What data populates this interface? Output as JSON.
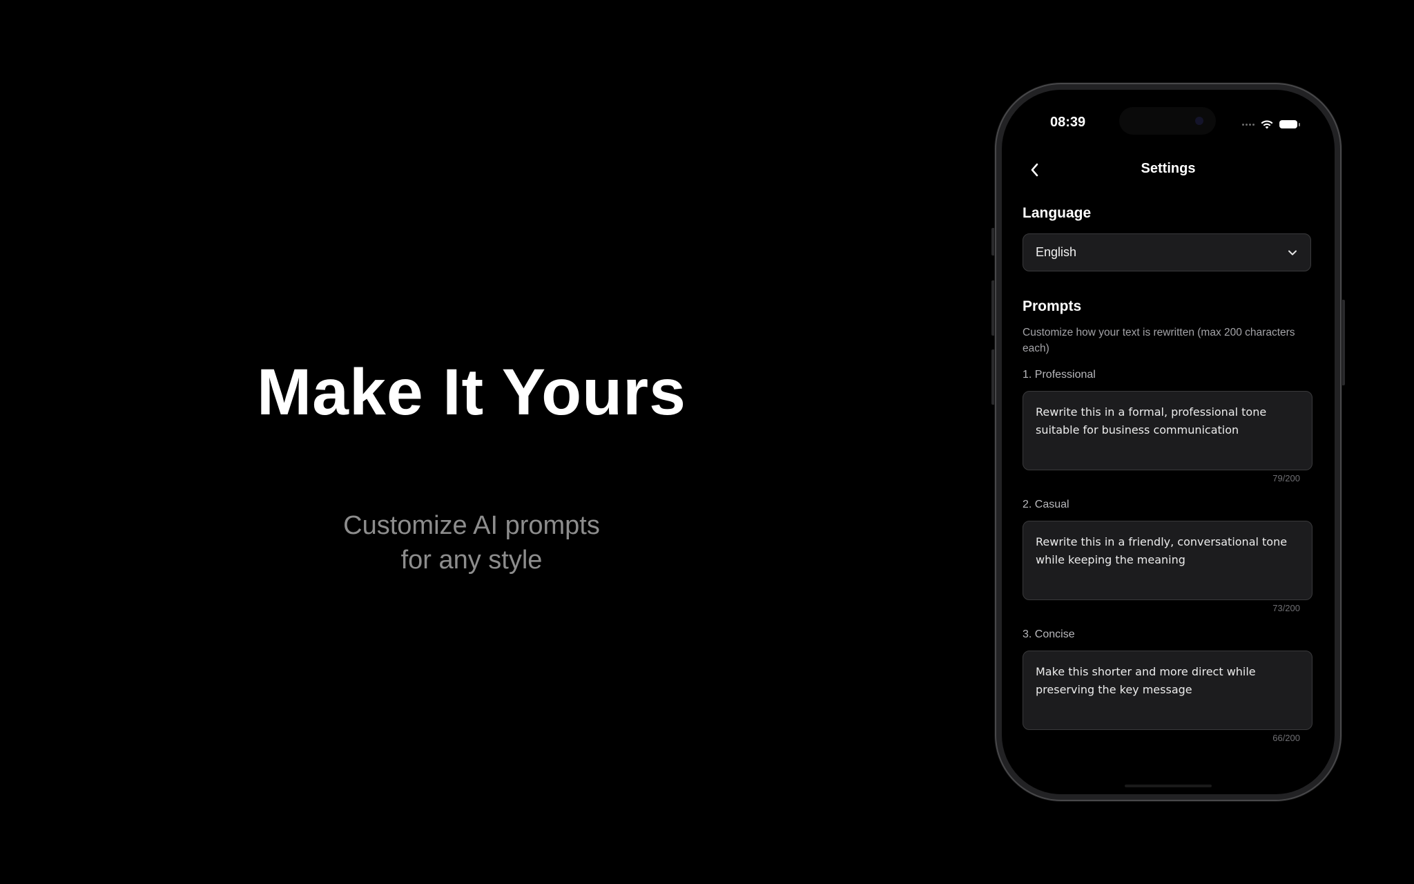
{
  "hero": {
    "title": "Make It Yours",
    "subtitle_line1": "Customize AI prompts",
    "subtitle_line2": "for any style"
  },
  "status_bar": {
    "time": "08:39",
    "icons": [
      "signal-dots-icon",
      "wifi-icon",
      "battery-icon"
    ]
  },
  "nav": {
    "title": "Settings",
    "back_icon": "chevron-left-icon"
  },
  "language": {
    "section_title": "Language",
    "selected": "English",
    "dropdown_icon": "chevron-down-icon"
  },
  "prompts": {
    "section_title": "Prompts",
    "description": "Customize how your text is rewritten (max 200 characters each)",
    "items": [
      {
        "label": "1. Professional",
        "text": "Rewrite this in a formal, professional tone suitable for business communication",
        "count": "79/200"
      },
      {
        "label": "2. Casual",
        "text": "Rewrite this in a friendly, conversational tone while keeping the meaning",
        "count": "73/200"
      },
      {
        "label": "3. Concise",
        "text": "Make this shorter and more direct while preserving the key message",
        "count": "66/200"
      }
    ]
  },
  "colors": {
    "background": "#000000",
    "field_background": "#1c1c1e",
    "field_border": "#3a3a3c",
    "subtitle": "#8d8d8d",
    "muted_text": "#a4a4a8"
  }
}
